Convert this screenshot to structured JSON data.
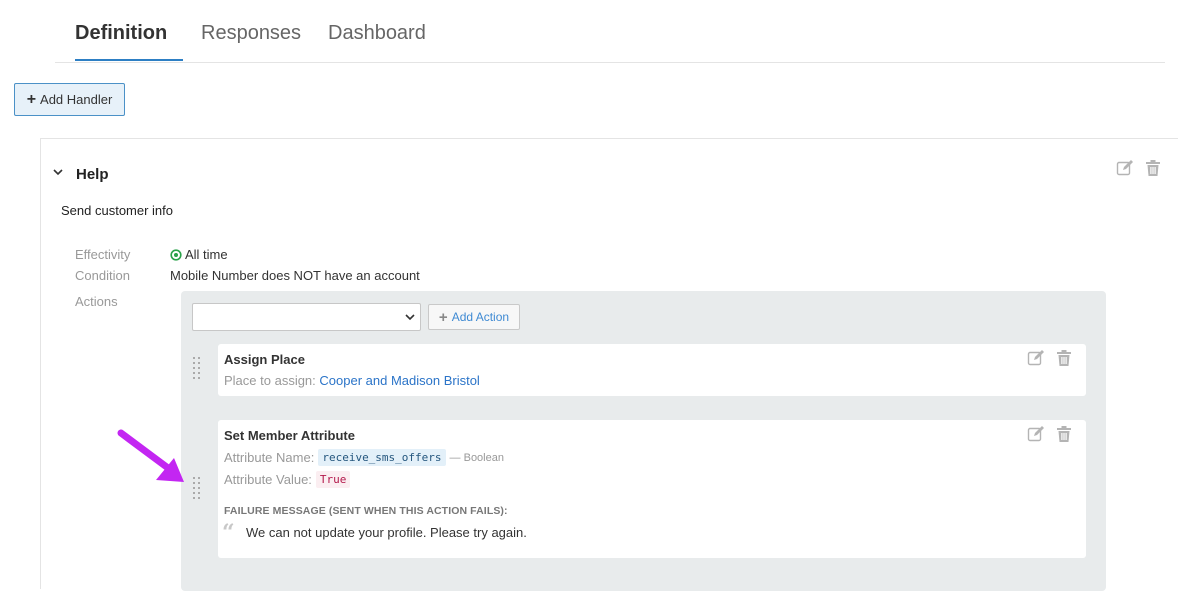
{
  "tabs": [
    {
      "label": "Definition",
      "active": true
    },
    {
      "label": "Responses",
      "active": false
    },
    {
      "label": "Dashboard",
      "active": false
    }
  ],
  "toolbar": {
    "add_handler_label": "Add Handler"
  },
  "handler": {
    "title": "Help",
    "description": "Send customer info",
    "effectivity_label": "Effectivity",
    "effectivity_value": "All time",
    "condition_label": "Condition",
    "condition_value": "Mobile Number does NOT have an account",
    "actions_label": "Actions"
  },
  "actions": {
    "select_value": "",
    "add_action_label": "Add Action",
    "items": [
      {
        "title": "Assign Place",
        "field_label": "Place to assign:",
        "field_value": "Cooper and Madison Bristol"
      },
      {
        "title": "Set Member Attribute",
        "attr_name_label": "Attribute Name:",
        "attr_name_value": "receive_sms_offers",
        "attr_type": "— Boolean",
        "attr_value_label": "Attribute Value:",
        "attr_value_value": "True",
        "failure_heading": "FAILURE MESSAGE (SENT WHEN THIS ACTION FAILS):",
        "failure_message": "We can not update your profile. Please try again."
      }
    ]
  },
  "colors": {
    "accent": "#2d7fc4",
    "success": "#2aa24a",
    "annotation_arrow": "#c326f2"
  },
  "icons": [
    "plus-icon",
    "chevron-down-icon",
    "edit-icon",
    "trash-icon",
    "check-circle-icon",
    "drag-handle-icon",
    "quote-icon",
    "arrow-annotation-icon"
  ]
}
